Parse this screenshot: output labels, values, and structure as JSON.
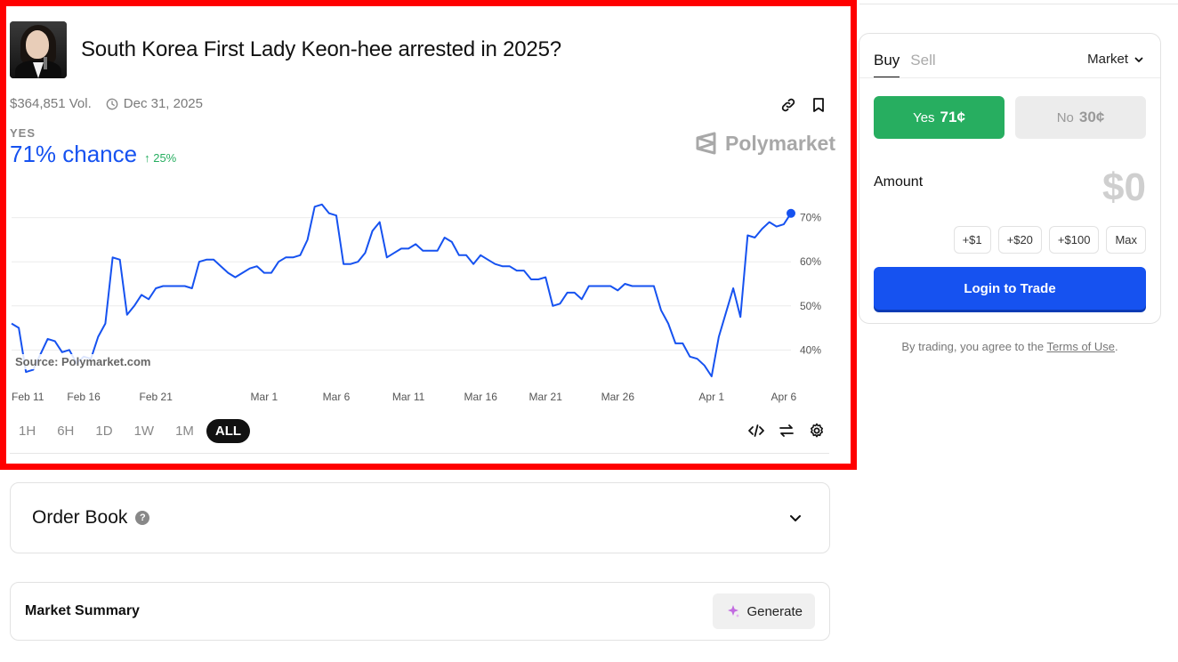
{
  "market": {
    "title": "South Korea First Lady Keon-hee arrested in 2025?",
    "volume": "$364,851 Vol.",
    "end_date": "Dec 31, 2025",
    "outcome_label": "YES",
    "chance": "71% chance",
    "delta": "↑ 25%",
    "brand": "Polymarket",
    "source": "Source: Polymarket.com"
  },
  "colors": {
    "accent_blue": "#1652f0",
    "positive_green": "#27ae60",
    "highlight_red": "#ff0000"
  },
  "icons": [
    "link-icon",
    "bookmark-icon",
    "clock-icon",
    "embed-code-icon",
    "swap-icon",
    "settings-icon",
    "chevron-down-icon",
    "sparkle-icon",
    "polymarket-logo"
  ],
  "time_ranges": [
    "1H",
    "6H",
    "1D",
    "1W",
    "1M",
    "ALL"
  ],
  "active_range": "ALL",
  "chart_data": {
    "type": "line",
    "series": [
      {
        "values": [
          46,
          45,
          35,
          35.5,
          39,
          42.5,
          42,
          39.5,
          40,
          37,
          38.5,
          38,
          43,
          46,
          61,
          60.5,
          48,
          50,
          52.5,
          51.5,
          54,
          54.5,
          54.5,
          54.5,
          54.5,
          54,
          60,
          60.5,
          60.5,
          59,
          57.5,
          56.5,
          57.5,
          58.5,
          59,
          57.5,
          57.5,
          60,
          61,
          61,
          61.5,
          65,
          72.5,
          73,
          71,
          70.5,
          59.5,
          59.5,
          60,
          62,
          67,
          69,
          61,
          62,
          63,
          63,
          64,
          62.5,
          62.5,
          62.5,
          65.5,
          64.5,
          61.5,
          61.5,
          59.5,
          61.5,
          60.5,
          59.5,
          59,
          59,
          58,
          58,
          56,
          56,
          56.5,
          50,
          50.5,
          53,
          53,
          51.5,
          54.5,
          54.5,
          54.5,
          54.5,
          53.5,
          55,
          54.5,
          54.5,
          54.5,
          54.5,
          49,
          46,
          41.5,
          41.5,
          38.5,
          38,
          36.5,
          34,
          43,
          48.5,
          54,
          47.5,
          66,
          65.5,
          67.5,
          69,
          68,
          68.5,
          71
        ]
      }
    ],
    "x_tick_labels": [
      "Feb 11",
      "Feb 16",
      "Feb 21",
      "Mar 1",
      "Mar 6",
      "Mar 11",
      "Mar 16",
      "Mar 21",
      "Mar 26",
      "Apr 1",
      "Apr 6"
    ],
    "y_tick_labels": [
      "70%",
      "60%",
      "50%",
      "40%"
    ],
    "y_ticks": [
      70,
      60,
      50,
      40
    ],
    "ylim": [
      33,
      77
    ],
    "grid": true,
    "line_color": "#1652f0"
  },
  "order_book": {
    "title": "Order Book",
    "help": "?"
  },
  "summary": {
    "title": "Market Summary",
    "generate_label": "Generate"
  },
  "trade": {
    "tab_buy": "Buy",
    "tab_sell": "Sell",
    "order_type": "Market",
    "yes_label": "Yes",
    "yes_price": "71¢",
    "no_label": "No",
    "no_price": "30¢",
    "amount_label": "Amount",
    "amount_value": "$0",
    "quick_amounts": [
      "+$1",
      "+$20",
      "+$100",
      "Max"
    ],
    "login_label": "Login to Trade",
    "terms_prefix": "By trading, you agree to the",
    "terms_link": "Terms of Use",
    "terms_suffix": "."
  }
}
